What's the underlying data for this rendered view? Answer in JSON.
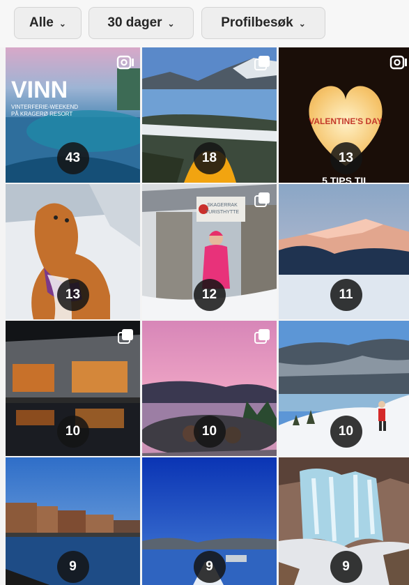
{
  "filters": {
    "type_label": "Alle",
    "period_label": "30 dager",
    "metric_label": "Profilbesøk"
  },
  "posts": [
    {
      "count": "43",
      "type_icon": "reel-icon",
      "overlay_title": "VINN",
      "overlay_sub1": "VINTERFERIE-WEEKEND",
      "overlay_sub2": "PÅ KRAGERØ RESORT"
    },
    {
      "count": "18",
      "type_icon": "carousel-icon"
    },
    {
      "count": "13",
      "type_icon": "reel-icon",
      "overlay_text": "VALENTINE'S DAY",
      "overlay_bottom": "5 TIPS TIL"
    },
    {
      "count": "13"
    },
    {
      "count": "12",
      "type_icon": "carousel-icon",
      "sign_line1": "SKAGERRAK",
      "sign_line2": "TURISTHYTTE"
    },
    {
      "count": "11"
    },
    {
      "count": "10",
      "type_icon": "carousel-icon"
    },
    {
      "count": "10",
      "type_icon": "carousel-icon"
    },
    {
      "count": "10"
    },
    {
      "count": "9"
    },
    {
      "count": "9"
    },
    {
      "count": "9"
    }
  ]
}
